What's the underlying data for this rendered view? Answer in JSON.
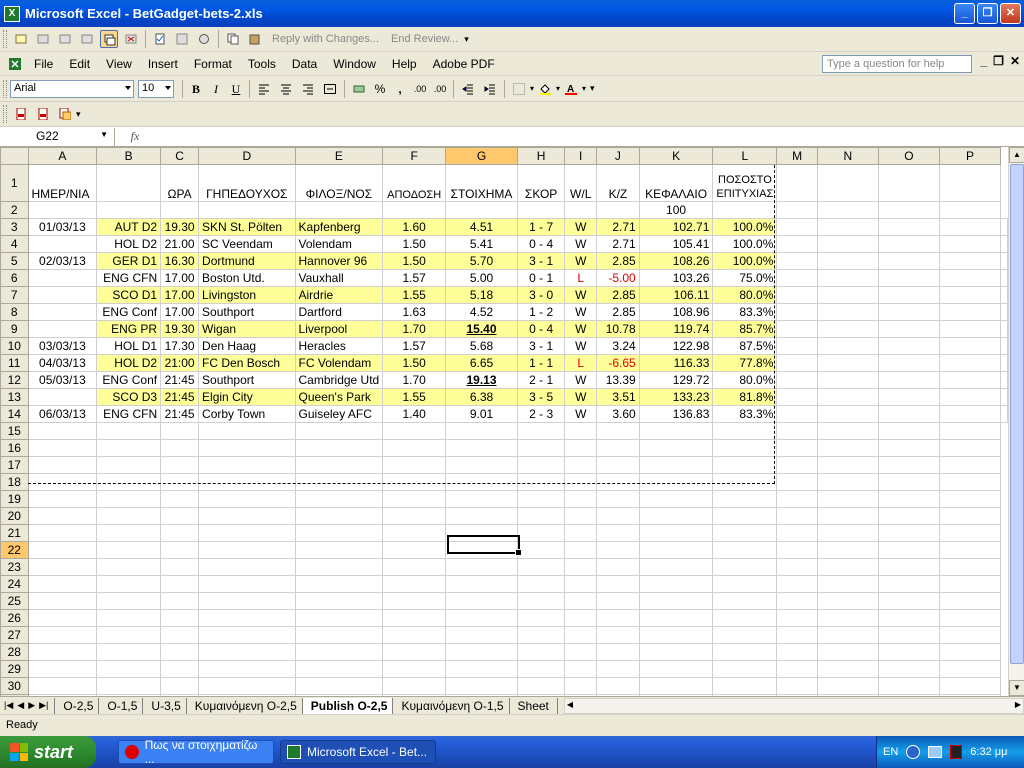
{
  "window": {
    "title": "Microsoft Excel - BetGadget-bets-2.xls",
    "min": "_",
    "max": "❐",
    "close": "✕"
  },
  "toolbar1": {
    "reply": "Reply with Changes...",
    "end_review": "End Review..."
  },
  "menu": [
    "File",
    "Edit",
    "View",
    "Insert",
    "Format",
    "Tools",
    "Data",
    "Window",
    "Help",
    "Adobe PDF"
  ],
  "help_placeholder": "Type a question for help",
  "format": {
    "font": "Arial",
    "size": "10",
    "bold": "B",
    "italic": "I",
    "underline": "U",
    "percent": "%",
    "comma": ",",
    "inc_dec": ".00",
    "dec_dec": ".00"
  },
  "namebox": "G22",
  "fx": "fx",
  "columns": [
    "A",
    "B",
    "C",
    "D",
    "E",
    "F",
    "G",
    "H",
    "I",
    "J",
    "K",
    "L",
    "M",
    "N",
    "O",
    "P"
  ],
  "selected_column": "G",
  "selected_row": 22,
  "header_row": [
    "ΗΜΕΡ/ΝΙΑ",
    "",
    "ΩΡΑ",
    "ΓΗΠΕΔΟΥΧΟΣ",
    "ΦΙΛΟΞ/ΝΟΣ",
    "ΑΠΟΔΟΣΗ",
    "ΣΤΟΙΧΗΜΑ",
    "ΣΚΟΡ",
    "W/L",
    "Κ/Ζ",
    "ΚΕΦΑΛΑΙΟ",
    "ΠΟΣΟΣΤΟ ΕΠΙΤΥΧΙΑΣ"
  ],
  "row2_capital": "100",
  "rows": [
    {
      "n": 3,
      "date": "01/03/13",
      "league": "AUT D2",
      "time": "19.30",
      "home": "SKN St. Pölten",
      "away": "Kapfenberg",
      "odds": "1.60",
      "stake": "4.51",
      "score": "1 - 7",
      "wl": "W",
      "pl": "2.71",
      "capital": "102.71",
      "pct": "100.0%",
      "yellow": true
    },
    {
      "n": 4,
      "date": "",
      "league": "HOL D2",
      "time": "21.00",
      "home": "SC Veendam",
      "away": "Volendam",
      "odds": "1.50",
      "stake": "5.41",
      "score": "0 - 4",
      "wl": "W",
      "pl": "2.71",
      "capital": "105.41",
      "pct": "100.0%",
      "yellow": false
    },
    {
      "n": 5,
      "date": "02/03/13",
      "league": "GER D1",
      "time": "16.30",
      "home": "Dortmund",
      "away": "Hannover 96",
      "odds": "1.50",
      "stake": "5.70",
      "score": "3 - 1",
      "wl": "W",
      "pl": "2.85",
      "capital": "108.26",
      "pct": "100.0%",
      "yellow": true
    },
    {
      "n": 6,
      "date": "",
      "league": "ENG CFN",
      "time": "17.00",
      "home": "Boston Utd.",
      "away": "Vauxhall",
      "odds": "1.57",
      "stake": "5.00",
      "score": "0 - 1",
      "wl": "L",
      "pl": "-5.00",
      "capital": "103.26",
      "pct": "75.0%",
      "yellow": false,
      "loss": true
    },
    {
      "n": 7,
      "date": "",
      "league": "SCO D1",
      "time": "17.00",
      "home": "Livingston",
      "away": "Airdrie",
      "odds": "1.55",
      "stake": "5.18",
      "score": "3 - 0",
      "wl": "W",
      "pl": "2.85",
      "capital": "106.11",
      "pct": "80.0%",
      "yellow": true
    },
    {
      "n": 8,
      "date": "",
      "league": "ENG Conf",
      "time": "17.00",
      "home": "Southport",
      "away": "Dartford",
      "odds": "1.63",
      "stake": "4.52",
      "score": "1 - 2",
      "wl": "W",
      "pl": "2.85",
      "capital": "108.96",
      "pct": "83.3%",
      "yellow": false
    },
    {
      "n": 9,
      "date": "",
      "league": "ENG PR",
      "time": "19.30",
      "home": "Wigan",
      "away": "Liverpool",
      "odds": "1.70",
      "stake": "15.40",
      "score": "0 - 4",
      "wl": "W",
      "pl": "10.78",
      "capital": "119.74",
      "pct": "85.7%",
      "yellow": true,
      "bold_stake": true
    },
    {
      "n": 10,
      "date": "03/03/13",
      "league": "HOL D1",
      "time": "17.30",
      "home": "Den Haag",
      "away": "Heracles",
      "odds": "1.57",
      "stake": "5.68",
      "score": "3 - 1",
      "wl": "W",
      "pl": "3.24",
      "capital": "122.98",
      "pct": "87.5%",
      "yellow": false
    },
    {
      "n": 11,
      "date": "04/03/13",
      "league": "HOL D2",
      "time": "21:00",
      "home": "FC Den Bosch",
      "away": "FC Volendam",
      "odds": "1.50",
      "stake": "6.65",
      "score": "1 - 1",
      "wl": "L",
      "pl": "-6.65",
      "capital": "116.33",
      "pct": "77.8%",
      "yellow": true,
      "loss": true
    },
    {
      "n": 12,
      "date": "05/03/13",
      "league": "ENG Conf",
      "time": "21:45",
      "home": "Southport",
      "away": "Cambridge Utd",
      "odds": "1.70",
      "stake": "19.13",
      "score": "2 - 1",
      "wl": "W",
      "pl": "13.39",
      "capital": "129.72",
      "pct": "80.0%",
      "yellow": false,
      "bold_stake": true
    },
    {
      "n": 13,
      "date": "",
      "league": "SCO D3",
      "time": "21:45",
      "home": "Elgin City",
      "away": "Queen's Park",
      "odds": "1.55",
      "stake": "6.38",
      "score": "3 - 5",
      "wl": "W",
      "pl": "3.51",
      "capital": "133.23",
      "pct": "81.8%",
      "yellow": true
    },
    {
      "n": 14,
      "date": "06/03/13",
      "league": "ENG CFN",
      "time": "21:45",
      "home": "Corby Town",
      "away": "Guiseley AFC",
      "odds": "1.40",
      "stake": "9.01",
      "score": "2 - 3",
      "wl": "W",
      "pl": "3.60",
      "capital": "136.83",
      "pct": "83.3%",
      "yellow": false
    }
  ],
  "sheet_tabs": [
    "O-2,5",
    "O-1,5",
    "U-3,5",
    "Κυμαινόμενη O-2,5",
    "Publish O-2,5",
    "Κυμαινόμενη O-1,5",
    "Sheet"
  ],
  "active_tab": "Publish O-2,5",
  "status": "Ready",
  "taskbar": {
    "start": "start",
    "task1": "Πως να στοιχηματίζω ...",
    "task2": "Microsoft Excel - Bet...",
    "lang": "EN",
    "clock": "6:32 μμ"
  }
}
